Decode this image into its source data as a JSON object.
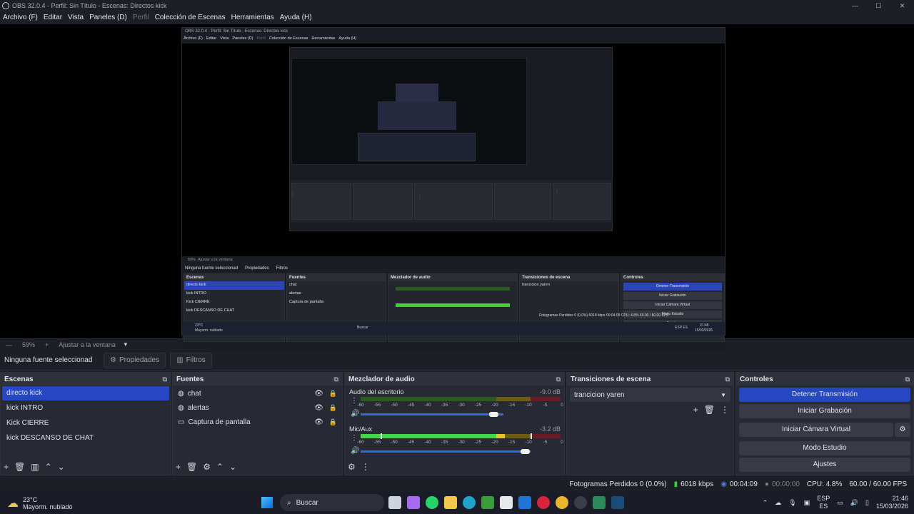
{
  "window": {
    "title": "OBS 32.0.4 - Perfil: Sin Título - Escenas: Directos kick",
    "minimize": "—",
    "maximize": "☐",
    "close": "✕"
  },
  "menu": [
    {
      "label": "Archivo (F)",
      "disabled": false
    },
    {
      "label": "Editar",
      "disabled": false
    },
    {
      "label": "Vista",
      "disabled": false
    },
    {
      "label": "Paneles (D)",
      "disabled": false
    },
    {
      "label": "Perfil",
      "disabled": true
    },
    {
      "label": "Colección de Escenas",
      "disabled": false
    },
    {
      "label": "Herramientas",
      "disabled": false
    },
    {
      "label": "Ayuda (H)",
      "disabled": false
    }
  ],
  "nested_preview": {
    "title": "OBS 32.0.4 - Perfil: Sin Título - Escenas: Directos kick",
    "menu": [
      "Archivo (F)",
      "Editar",
      "Vista",
      "Paneles (D)",
      "Perfil",
      "Colección de Escenas",
      "Herramientas",
      "Ayuda (H)"
    ],
    "zoom": "59%",
    "zoom_mode": "Ajustar a la ventana",
    "no_source": "Ninguna fuente seleccionad",
    "properties": "Propiedades",
    "filters": "Filtros",
    "docks": {
      "scenes": "Escenas",
      "sources": "Fuentes",
      "mixer": "Mezclador de audio",
      "transitions": "Transiciones de escena",
      "controls": "Controles"
    },
    "status": "Fotogramas Perdidos 0 (0,0%)   6018 kbps   00:04:09   CPU: 4.8%   60.00 / 60.00 FPS",
    "weather_temp": "23°C",
    "weather_desc": "Mayorm. nublado",
    "search": "Buscar",
    "lang": "ESP ES",
    "time": "21:46",
    "date": "15/03/2026"
  },
  "zoom": {
    "minus": "—",
    "value": "59%",
    "plus": "+",
    "mode": "Ajustar a la ventana",
    "arrow": "▼"
  },
  "source_bar": {
    "none_selected": "Ninguna fuente seleccionad",
    "properties": "Propiedades",
    "filters": "Filtros"
  },
  "scenes": {
    "title": "Escenas",
    "items": [
      "directo kick",
      "kick INTRO",
      "Kick CIERRE",
      "kick DESCANSO DE CHAT"
    ],
    "selected": 0
  },
  "sources": {
    "title": "Fuentes",
    "items": [
      {
        "label": "chat",
        "icon": "browser-icon"
      },
      {
        "label": "alertas",
        "icon": "browser-icon"
      },
      {
        "label": "Captura de pantalla",
        "icon": "monitor-icon"
      }
    ]
  },
  "mixer": {
    "title": "Mezclador de audio",
    "channels": [
      {
        "name": "Audio del escritorio",
        "db": "-9.0 dB",
        "level": 0.0,
        "volume": 0.72
      },
      {
        "name": "Mic/Aux",
        "db": "-3.2 dB",
        "level": 0.85,
        "volume": 0.86
      }
    ],
    "ticks": [
      "-60",
      "-55",
      "-50",
      "-45",
      "-40",
      "-35",
      "-30",
      "-25",
      "-20",
      "-15",
      "-10",
      "-5",
      "0"
    ]
  },
  "transitions": {
    "title": "Transiciones de escena",
    "selected": "trancicion yaren"
  },
  "controls": {
    "title": "Controles",
    "stop_stream": "Detener Transmisión",
    "start_recording": "Iniciar Grabación",
    "start_vcam": "Iniciar Cámara Virtual",
    "studio_mode": "Modo Estudio",
    "settings": "Ajustes"
  },
  "status": {
    "dropped": "Fotogramas Perdidos 0 (0.0%)",
    "bitrate": "6018 kbps",
    "stream_time": "00:04:09",
    "rec_time": "00:00:00",
    "cpu": "CPU: 4.8%",
    "fps": "60.00 / 60.00 FPS"
  },
  "taskbar": {
    "temp": "23°C",
    "weather": "Mayorm. nublado",
    "search": "Buscar",
    "lang1": "ESP",
    "lang2": "ES",
    "time": "21:46",
    "date": "15/03/2026"
  },
  "colors": {
    "accent": "#2547c1",
    "background": "#1d1f26",
    "panel": "#272a33"
  }
}
